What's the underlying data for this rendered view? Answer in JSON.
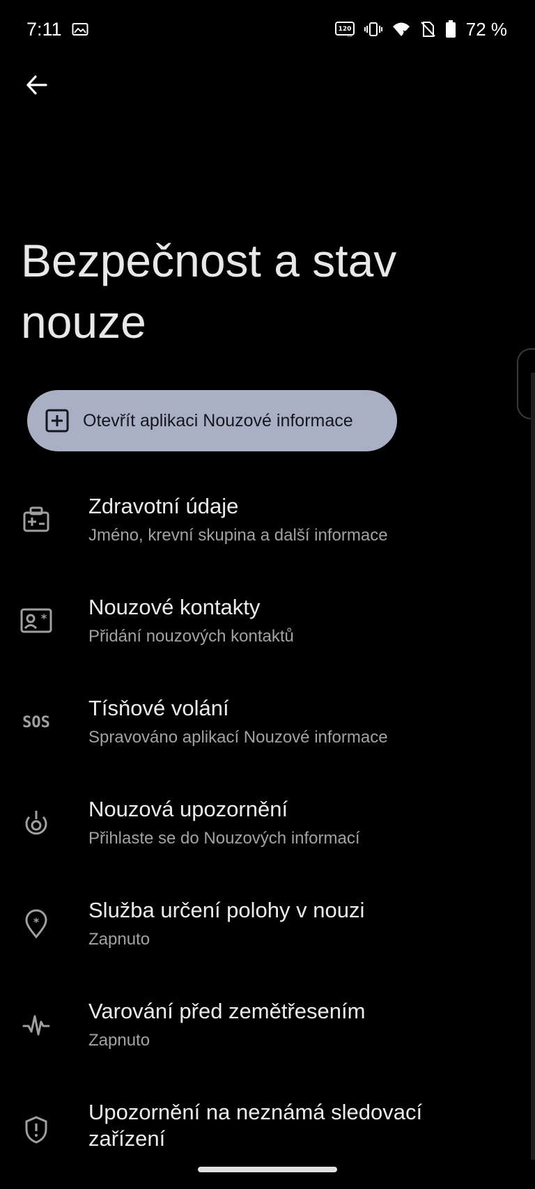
{
  "status_bar": {
    "time": "7:11",
    "battery_text": "72 %",
    "refresh_badge_top": "120",
    "refresh_badge_bottom": "Hz",
    "icons": [
      "gallery-icon",
      "refresh-rate-icon",
      "vibrate-icon",
      "wifi-icon",
      "no-sim-icon",
      "battery-icon"
    ]
  },
  "header": {
    "title": "Bezpečnost a stav nouze"
  },
  "open_app_button": {
    "label": "Otevřít aplikaci Nouzové informace",
    "icon": "add-box-icon"
  },
  "items": [
    {
      "title": "Zdravotní údaje",
      "subtitle": "Jméno, krevní skupina a další informace",
      "icon": "medical-info-icon"
    },
    {
      "title": "Nouzové kontakty",
      "subtitle": "Přidání nouzových kontaktů",
      "icon": "emergency-contact-icon"
    },
    {
      "title": "Tísňové volání",
      "subtitle": "Spravováno aplikací Nouzové informace",
      "icon": "sos-icon",
      "icon_text": "SOS"
    },
    {
      "title": "Nouzová upozornění",
      "subtitle": "Přihlaste se do Nouzových informací",
      "icon": "emergency-alert-icon"
    },
    {
      "title": "Služba určení polohy v nouzi",
      "subtitle": "Zapnuto",
      "icon": "emergency-location-icon"
    },
    {
      "title": "Varování před zemětřesením",
      "subtitle": "Zapnuto",
      "icon": "earthquake-icon"
    },
    {
      "title": "Upozornění na neznámá sledovací zařízení",
      "subtitle": "",
      "icon": "shield-alert-icon"
    }
  ],
  "colors": {
    "background": "#000000",
    "button_bg": "#a9b0c3",
    "title_text": "#e8e8e8",
    "subtitle_text": "#a2a2a2"
  }
}
